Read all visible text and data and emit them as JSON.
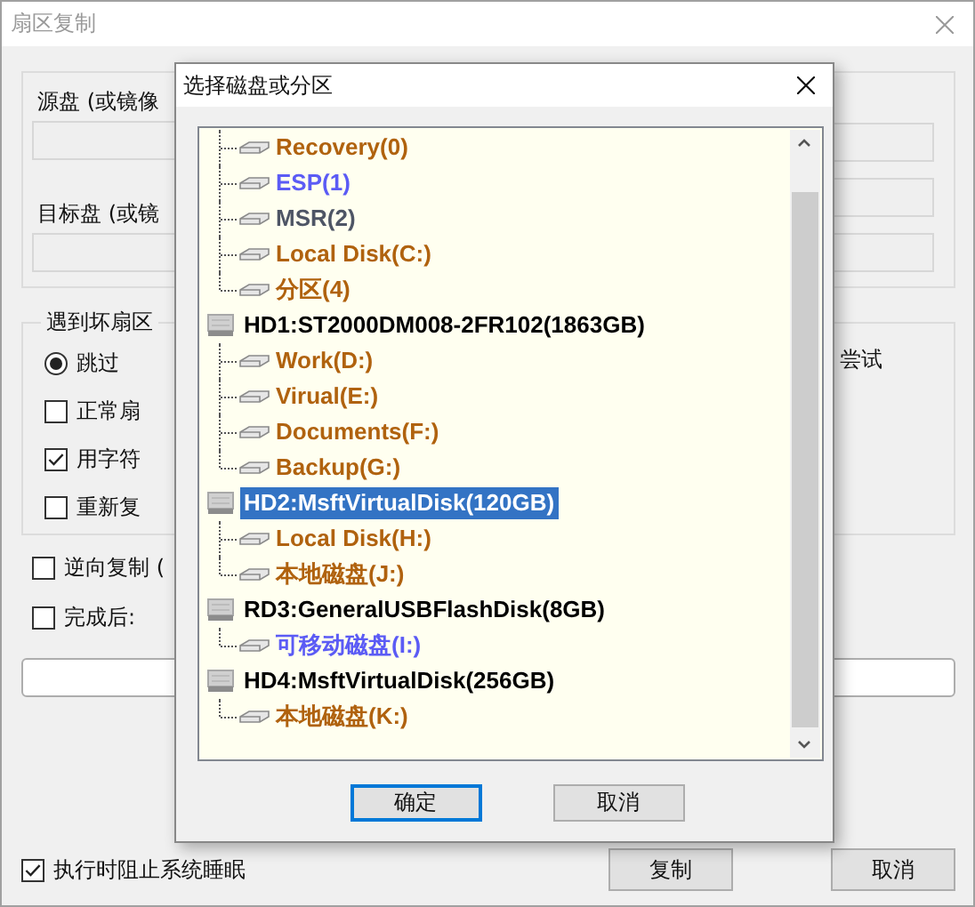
{
  "back_window": {
    "title": "扇区复制",
    "source_label": "源盘 (或镜像",
    "target_label": "目标盘 (或镜",
    "bad_sector_group": {
      "title": "遇到坏扇区",
      "right_text": "尝试",
      "options": [
        {
          "kind": "radio",
          "label": "跳过",
          "checked": true
        },
        {
          "kind": "checkbox",
          "label": "正常扇",
          "checked": false
        },
        {
          "kind": "checkbox",
          "label": "用字符",
          "checked": true
        },
        {
          "kind": "checkbox",
          "label": "重新复",
          "checked": false
        }
      ]
    },
    "options": [
      {
        "label": "逆向复制 (",
        "checked": false
      },
      {
        "label": "完成后:",
        "checked": false
      }
    ],
    "prevent_sleep": {
      "label": "执行时阻止系统睡眠",
      "checked": true
    },
    "buttons": [
      "复制",
      "取消"
    ]
  },
  "dialog": {
    "title": "选择磁盘或分区",
    "tree": {
      "partitions": [
        {
          "label": "Recovery(0)",
          "color": "#b0620e"
        },
        {
          "label": "ESP(1)",
          "color": "#5b5bf5"
        },
        {
          "label": "MSR(2)",
          "color": "#4e5565"
        },
        {
          "label": "Local Disk(C:)",
          "color": "#b0620e"
        },
        {
          "label": "分区(4)",
          "color": "#b0620e"
        }
      ],
      "disks": [
        {
          "label": "HD1:ST2000DM008-2FR102(1863GB)",
          "selected": false,
          "children": [
            {
              "label": "Work(D:)",
              "color": "#b0620e"
            },
            {
              "label": "Virual(E:)",
              "color": "#b0620e"
            },
            {
              "label": "Documents(F:)",
              "color": "#b0620e"
            },
            {
              "label": "Backup(G:)",
              "color": "#b0620e"
            }
          ]
        },
        {
          "label": "HD2:MsftVirtualDisk(120GB)",
          "selected": true,
          "children": [
            {
              "label": "Local Disk(H:)",
              "color": "#b0620e"
            },
            {
              "label": "本地磁盘(J:)",
              "color": "#b0620e"
            }
          ]
        },
        {
          "label": "RD3:GeneralUSBFlashDisk(8GB)",
          "selected": false,
          "children": [
            {
              "label": "可移动磁盘(I:)",
              "color": "#5b5bf5"
            }
          ]
        },
        {
          "label": "HD4:MsftVirtualDisk(256GB)",
          "selected": false,
          "children": [
            {
              "label": "本地磁盘(K:)",
              "color": "#b0620e"
            }
          ]
        }
      ]
    },
    "buttons": [
      {
        "label": "确定",
        "default": true
      },
      {
        "label": "取消",
        "default": false
      }
    ]
  }
}
